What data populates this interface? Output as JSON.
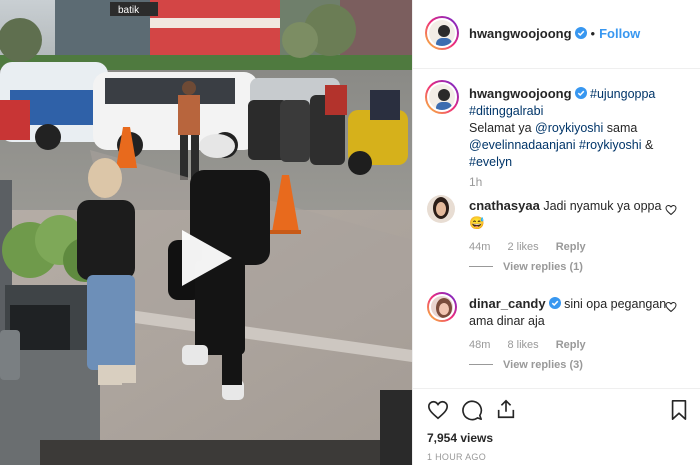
{
  "post": {
    "author": "hwangwoojoong",
    "follow_label": "Follow",
    "separator": "•"
  },
  "caption": {
    "author": "hwangwoojoong",
    "hashtag1": "#ujungoppa",
    "hashtag2": "#ditinggalrabi",
    "text1": "Selamat ya",
    "mention1": "@roykiyoshi",
    "text2": "sama",
    "mention2": "@evelinnadaanjani",
    "hashtag3": "#roykiyoshi",
    "text3": "&",
    "hashtag4": "#evelyn",
    "time": "1h"
  },
  "comments": [
    {
      "username": "cnathasyaa",
      "text": "Jadi nyamuk ya oppa 😅",
      "time": "44m",
      "likes": "2 likes",
      "reply_label": "Reply",
      "view_replies": "View replies (1)"
    },
    {
      "username": "dinar_candy",
      "text": "sini opa pegangan ama dinar aja",
      "time": "48m",
      "likes": "8 likes",
      "reply_label": "Reply",
      "view_replies": "View replies (3)"
    }
  ],
  "stats": {
    "views": "7,954 views",
    "posted": "1 HOUR AGO"
  },
  "media": {
    "shop_sign": "batik"
  },
  "colors": {
    "link": "#003569",
    "follow": "#3897f0",
    "verified": "#3897f0",
    "muted": "#999999"
  },
  "icons": [
    "verified-badge-icon",
    "play-icon",
    "heart-icon",
    "comment-icon",
    "share-icon",
    "bookmark-icon"
  ]
}
